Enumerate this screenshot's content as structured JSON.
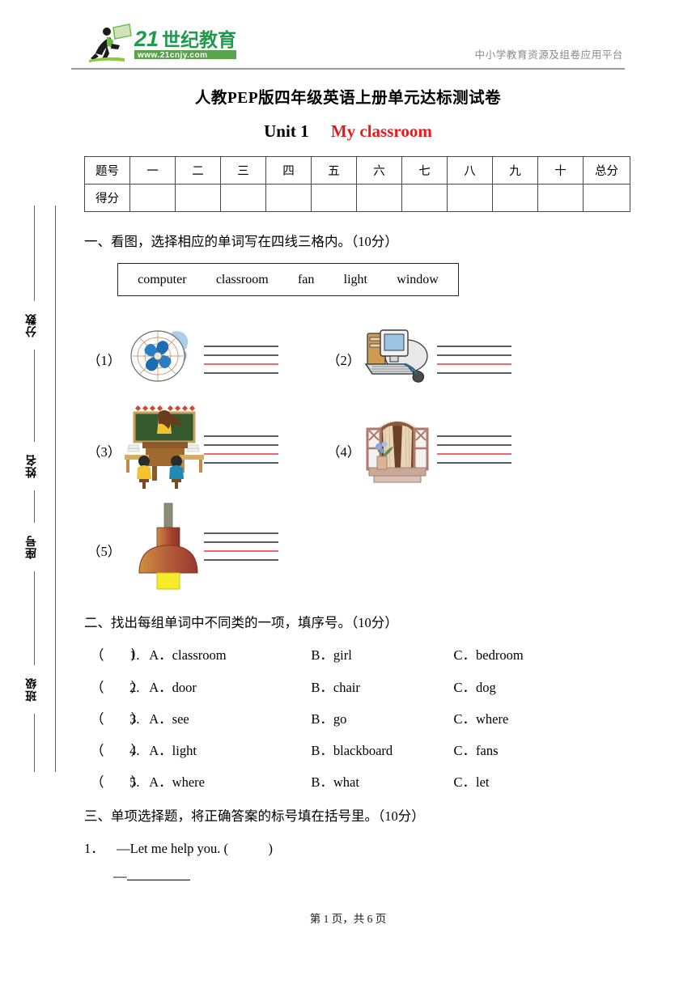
{
  "header": {
    "logo_text": "21世纪教育",
    "logo_url": "www.21cnjy.com",
    "tagline": "中小学教育资源及组卷应用平台"
  },
  "title": {
    "main": "人教PEP版四年级英语上册单元达标测试卷",
    "unit_no": "Unit 1",
    "unit_name": "My classroom",
    "unit_name_color": "#e8191b"
  },
  "score_table": {
    "row_labels": [
      "题号",
      "得分"
    ],
    "columns": [
      "一",
      "二",
      "三",
      "四",
      "五",
      "六",
      "七",
      "八",
      "九",
      "十",
      "总分"
    ],
    "scores": [
      "",
      "",
      "",
      "",
      "",
      "",
      "",
      "",
      "",
      "",
      ""
    ]
  },
  "side_band": {
    "labels": [
      "分数",
      "姓名",
      "座号",
      "班级"
    ]
  },
  "section1": {
    "heading": "一、看图，选择相应的单词写在四线三格内。（10分）",
    "word_bank": [
      "computer",
      "classroom",
      "fan",
      "light",
      "window"
    ],
    "items": [
      {
        "number": "（1）",
        "picture": "fan-icon"
      },
      {
        "number": "（2）",
        "picture": "computer-icon"
      },
      {
        "number": "（3）",
        "picture": "classroom-icon"
      },
      {
        "number": "（4）",
        "picture": "window-icon"
      },
      {
        "number": "（5）",
        "picture": "light-icon"
      }
    ]
  },
  "section2": {
    "heading": "二、找出每组单词中不同类的一项，填序号。（10分）",
    "items": [
      {
        "paren": "（　　）",
        "index": "1.",
        "a": "A．classroom",
        "b": "B．girl",
        "c": "C．bedroom"
      },
      {
        "paren": "（　　）",
        "index": "2.",
        "a": "A．door",
        "b": "B．chair",
        "c": "C．dog"
      },
      {
        "paren": "（　　）",
        "index": "3.",
        "a": "A．see",
        "b": "B．go",
        "c": "C．where"
      },
      {
        "paren": "（　　）",
        "index": "4.",
        "a": "A．light",
        "b": "B．blackboard",
        "c": "C．fans"
      },
      {
        "paren": "（　　）",
        "index": "5.",
        "a": "A．where",
        "b": "B．what",
        "c": "C．let"
      }
    ]
  },
  "section3": {
    "heading": "三、单项选择题，将正确答案的标号填在括号里。（10分）",
    "q1_number": "1．",
    "q1_prompt": "—Let me help you. (　　　)",
    "q1_answer_dash": "—"
  },
  "footer": {
    "page_text": "第 1 页，共 6 页"
  }
}
